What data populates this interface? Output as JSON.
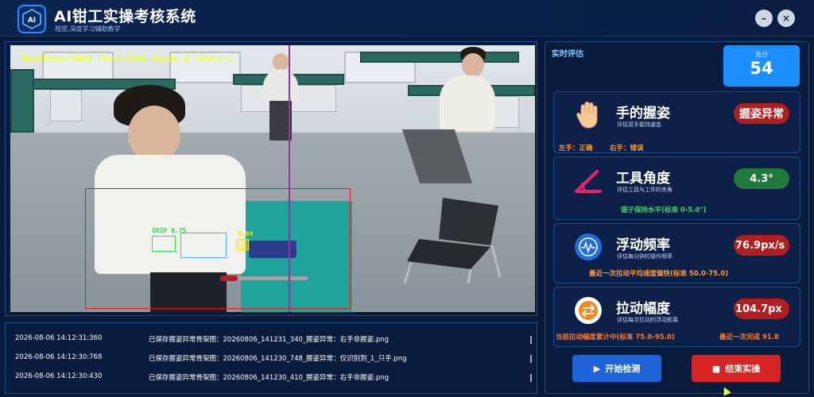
{
  "app": {
    "title": "AI钳工实操考核系统",
    "subtitle": "视觉,深度学习辅助教学",
    "logo_text": "AI",
    "minimize_glyph": "–",
    "close_glyph": "×"
  },
  "video": {
    "hud": "HandPose:CUDA Tool:CUDA hands:2 tools:1",
    "detections": [
      {
        "label": "GRIP 0.75",
        "color": "#2ee04a"
      },
      {
        "label": "0.84",
        "color": "#ffe800"
      }
    ]
  },
  "log": {
    "entries": [
      {
        "time": "2026-08-06 14:12:31:360",
        "message": "已保存握姿异常骨架图：20260806_141231_340_握姿异常：右手非握姿.png"
      },
      {
        "time": "2026-08-06 14:12:30:768",
        "message": "已保存握姿异常骨架图：20260806_141230_748_握姿异常：仅识别到_1_只手.png"
      },
      {
        "time": "2026-08-06 14:12:30:430",
        "message": "已保存握姿异常骨架图：20260806_141230_410_握姿异常：右手非握姿.png"
      }
    ]
  },
  "evaluation": {
    "label": "实时评估",
    "score_caption": "总分",
    "score": "54",
    "cards": [
      {
        "icon": "hand-icon",
        "title": "手的握姿",
        "subtitle": "评估双手握持姿态",
        "badge": "握姿异常",
        "badge_color": "#b01e1e",
        "notes": [
          {
            "text": "左手：正确",
            "color": "#ff9a3c"
          },
          {
            "text": "右手：错误",
            "color": "#ff9a3c"
          }
        ]
      },
      {
        "icon": "angle-icon",
        "title": "工具角度",
        "subtitle": "评估工具与工件的夹角",
        "badge": "4.3°",
        "badge_color": "#1f7a3c",
        "notes": [
          {
            "text": "锯子保持水平(标准 0-5.0°)",
            "color": "#3fd46a"
          }
        ]
      },
      {
        "icon": "frequency-icon",
        "title": "浮动频率",
        "subtitle": "评估每分钟的操作频率",
        "badge": "76.9px/s",
        "badge_color": "#b01e1e",
        "notes": [
          {
            "text": "最近一次拉动平均速度偏快(标准 50.0-75.0)",
            "color": "#ff9a3c"
          }
        ]
      },
      {
        "icon": "swap-icon",
        "title": "拉动幅度",
        "subtitle": "评估每次拉动的浮动距离",
        "badge": "104.7px",
        "badge_color": "#b01e1e",
        "notes": [
          {
            "text": "当前拉动幅度累计中(标准 75.0-95.0)",
            "color": "#ff7a2a"
          },
          {
            "text": "最近一次完成 91.8",
            "color": "#ff7a2a"
          }
        ]
      }
    ]
  },
  "actions": {
    "start_label": "开始检测",
    "stop_label": "结束实操"
  },
  "colors": {
    "background": "#071a3a",
    "panel_border": "#1f4b8f",
    "accent": "#1e8fff"
  }
}
